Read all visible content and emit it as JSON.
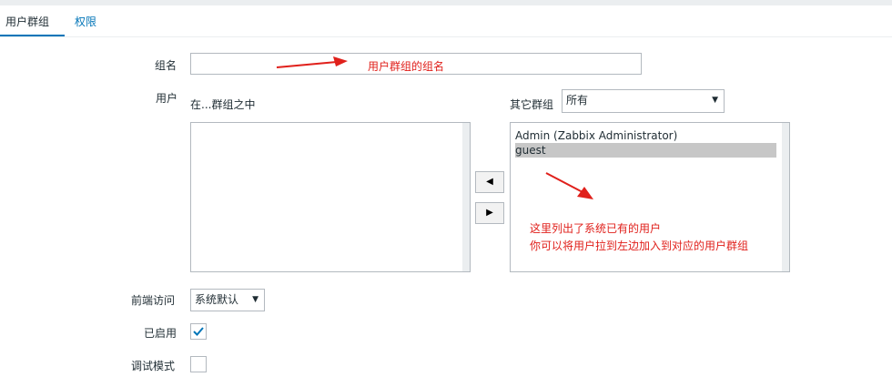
{
  "tabs": [
    {
      "label": "用户群组",
      "active": true
    },
    {
      "label": "权限",
      "active": false
    }
  ],
  "form": {
    "group_name_label": "组名",
    "group_name_value": "",
    "users_label": "用户",
    "in_groups_label": "在...群组之中",
    "other_groups_label": "其它群组",
    "other_groups_select_value": "所有",
    "other_users": [
      "Admin (Zabbix Administrator)",
      "guest"
    ],
    "selected_other_user": "guest",
    "frontend_access_label": "前端访问",
    "frontend_access_value": "系统默认",
    "enabled_label": "已启用",
    "enabled_checked": true,
    "debug_label": "调试模式",
    "debug_checked": false
  },
  "icons": {
    "move_left": "triangle-left-icon",
    "move_right": "triangle-right-icon",
    "dropdown": "triangle-down-icon",
    "check": "check-icon"
  },
  "annotations": {
    "group_name_note": "用户群组的组名",
    "users_note_line1": "这里列出了系统已有的用户",
    "users_note_line2": "你可以将用户拉到左边加入到对应的用户群组"
  },
  "colors": {
    "accent": "#0275b8",
    "annotation": "#e0201b",
    "selection": "#c7c7c7"
  }
}
